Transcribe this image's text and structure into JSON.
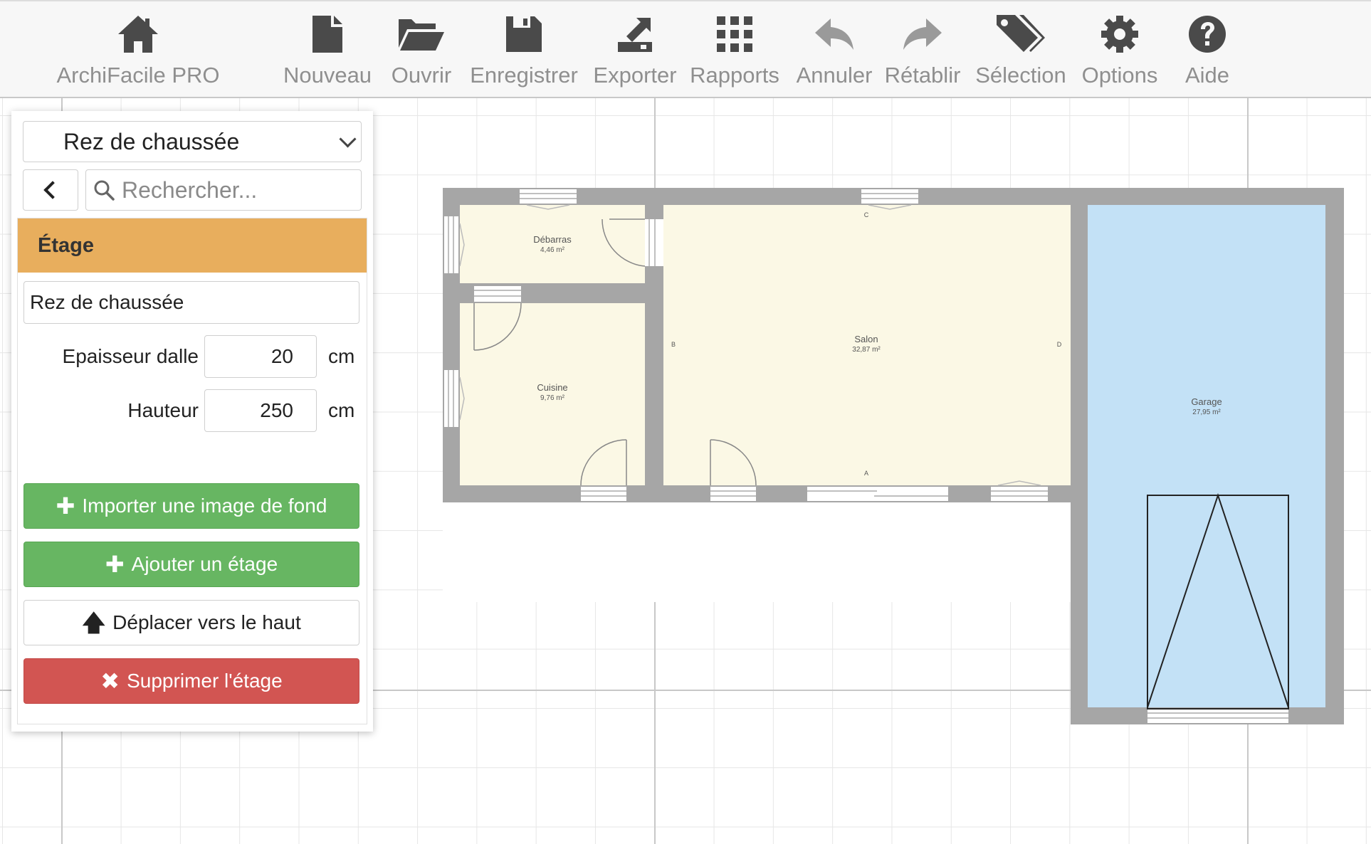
{
  "toolbar": {
    "items": [
      {
        "label": "ArchiFacile PRO",
        "icon": "home-icon"
      },
      {
        "label": "Nouveau",
        "icon": "new-file-icon"
      },
      {
        "label": "Ouvrir",
        "icon": "folder-open-icon"
      },
      {
        "label": "Enregistrer",
        "icon": "save-icon"
      },
      {
        "label": "Exporter",
        "icon": "export-icon"
      },
      {
        "label": "Rapports",
        "icon": "grid-icon"
      },
      {
        "label": "Annuler",
        "icon": "undo-icon"
      },
      {
        "label": "Rétablir",
        "icon": "redo-icon"
      },
      {
        "label": "Sélection",
        "icon": "tags-icon"
      },
      {
        "label": "Options",
        "icon": "gear-icon"
      },
      {
        "label": "Aide",
        "icon": "help-icon"
      }
    ]
  },
  "panel": {
    "level_select": "Rez de chaussée",
    "search_placeholder": "Rechercher...",
    "section_title": "Étage",
    "level_name": "Rez de chaussée",
    "slab_label": "Epaisseur dalle",
    "slab_value": "20",
    "slab_unit": "cm",
    "height_label": "Hauteur",
    "height_value": "250",
    "height_unit": "cm",
    "import_label": "Importer une image de fond",
    "add_label": "Ajouter un étage",
    "move_up_label": "Déplacer vers le haut",
    "delete_label": "Supprimer l'étage"
  },
  "plan": {
    "rooms": [
      {
        "name": "Débarras",
        "area": "4,46 m²"
      },
      {
        "name": "Cuisine",
        "area": "9,76 m²"
      },
      {
        "name": "Salon",
        "area": "32,87 m²"
      },
      {
        "name": "Garage",
        "area": "27,95 m²"
      }
    ],
    "wall_markers": [
      "C",
      "B",
      "D",
      "A"
    ],
    "colors": {
      "wall": "#a6a6a6",
      "room": "#fbf8e5",
      "garage": "#c3e1f6"
    }
  }
}
